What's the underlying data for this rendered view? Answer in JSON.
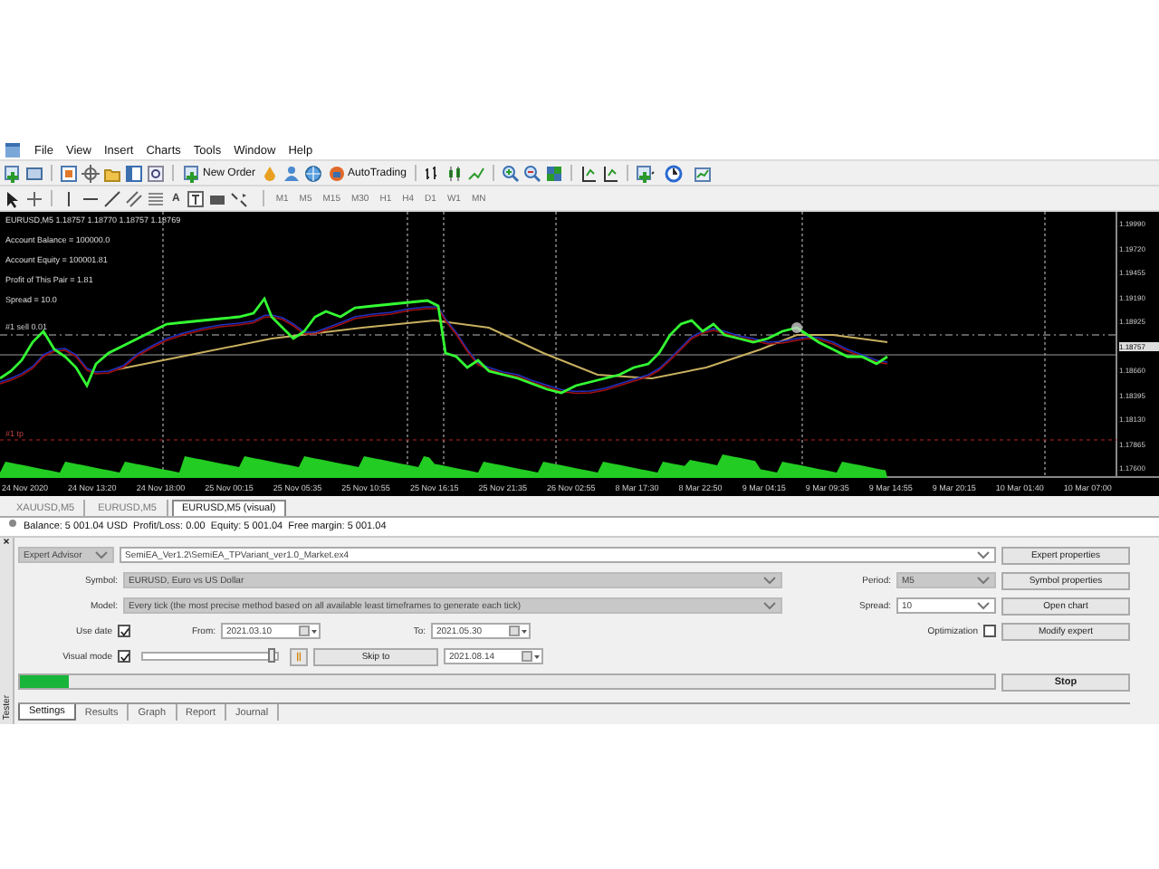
{
  "menu": [
    "File",
    "View",
    "Insert",
    "Charts",
    "Tools",
    "Window",
    "Help"
  ],
  "toolbar": {
    "new_order": "New Order",
    "autotrading": "AutoTrading"
  },
  "drawing_tools": {
    "text_tool": "A"
  },
  "timeframes": [
    {
      "label": "M1",
      "disabled": true
    },
    {
      "label": "M5",
      "disabled": true
    },
    {
      "label": "M15",
      "disabled": true
    },
    {
      "label": "M30",
      "disabled": true
    },
    {
      "label": "H1",
      "disabled": true
    },
    {
      "label": "H4",
      "disabled": true
    },
    {
      "label": "D1",
      "disabled": true
    },
    {
      "label": "W1",
      "disabled": true
    },
    {
      "label": "MN",
      "disabled": true
    }
  ],
  "chart": {
    "info": "EURUSD,M5  1.18757 1.18770 1.18757 1.18769",
    "stats": [
      "Account Balance = 100000.0",
      "Account Equity = 100001.81",
      "Profit of This Pair = 1.81",
      "Spread = 10.0"
    ],
    "order_labels": [
      {
        "text": "#1 sell 0.01",
        "kind": "sell"
      },
      {
        "text": "#1 tp",
        "kind": "tp"
      }
    ],
    "price_axis": [
      {
        "label": "1.19990",
        "current": false
      },
      {
        "label": "1.19720",
        "current": false
      },
      {
        "label": "1.19455",
        "current": false
      },
      {
        "label": "1.19190",
        "current": false
      },
      {
        "label": "1.18925",
        "current": false
      },
      {
        "label": "1.18757",
        "current": true
      },
      {
        "label": "1.18660",
        "current": false
      },
      {
        "label": "1.18395",
        "current": false
      },
      {
        "label": "1.18130",
        "current": false
      },
      {
        "label": "1.17865",
        "current": false
      },
      {
        "label": "1.17600",
        "current": false
      }
    ],
    "time_axis": [
      "24 Nov 2020",
      "24 Nov 13:20",
      "24 Nov 18:00",
      "25 Nov 00:15",
      "25 Nov 05:35",
      "25 Nov 10:55",
      "25 Nov 16:15",
      "25 Nov 21:35",
      "26 Nov 02:55",
      "8 Mar 17:30",
      "8 Mar 22:50",
      "9 Mar 04:15",
      "9 Mar 09:35",
      "9 Mar 14:55",
      "9 Mar 20:15",
      "10 Mar 01:40",
      "10 Mar 07:00"
    ]
  },
  "chart_tabs": [
    {
      "label": "XAUUSD,M5",
      "selected": false
    },
    {
      "label": "EURUSD,M5",
      "selected": false
    },
    {
      "label": "EURUSD,M5 (visual)",
      "selected": true
    }
  ],
  "status_line": "Balance: 5 001.04 USD  Profit/Loss: 0.00  Equity: 5 001.04  Free margin: 5 001.04",
  "tester": {
    "side_label": "Tester",
    "close": "×",
    "program_type": {
      "value": "Expert Advisor",
      "disabled": true
    },
    "expert_file": {
      "value": "SemiEA_Ver1.2\\SemiEA_TPVariant_ver1.0_Market.ex4",
      "disabled": false
    },
    "symbol": {
      "label": "Symbol:",
      "value": "EURUSD, Euro vs US Dollar",
      "disabled": true
    },
    "model": {
      "label": "Model:",
      "value": "Every tick (the most precise method based on all available least timeframes to generate each tick)",
      "disabled": true
    },
    "period": {
      "label": "Period:",
      "value": "M5",
      "disabled": true
    },
    "spread": {
      "label": "Spread:",
      "value": "10",
      "disabled": false
    },
    "use_date": {
      "label": "Use date",
      "checked": true
    },
    "from": {
      "label": "From:",
      "value": "2021.03.10"
    },
    "to": {
      "label": "To:",
      "value": "2021.05.30"
    },
    "optimization": {
      "label": "Optimization",
      "checked": false
    },
    "visual_mode": {
      "label": "Visual mode",
      "checked": true
    },
    "speed": {
      "level": 1.0
    },
    "pause": "||",
    "skip_to": "Skip to",
    "skip_date": "2021.08.14",
    "progress": {
      "level": 0.05
    },
    "buttons": [
      "Expert properties",
      "Symbol properties",
      "Open chart",
      "Modify expert"
    ],
    "stop": "Stop",
    "tabs": [
      {
        "label": "Settings",
        "selected": true
      },
      {
        "label": "Results",
        "selected": false
      },
      {
        "label": "Graph",
        "selected": false
      },
      {
        "label": "Report",
        "selected": false
      },
      {
        "label": "Journal",
        "selected": false
      }
    ]
  }
}
